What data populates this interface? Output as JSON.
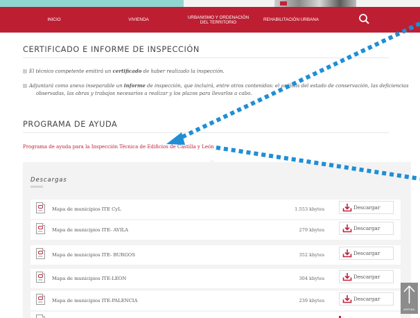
{
  "nav": {
    "items": [
      "INICIO",
      "VIVIENDA",
      "URBANISMO Y ORDENACIÓN\nDEL TERRITORIO",
      "REHABILITACIÓN URBANA"
    ]
  },
  "certificado": {
    "title": "CERTIFICADO E INFORME DE INSPECCIÓN",
    "p1": {
      "a": "El técnico competente emitirá un ",
      "b": "certificado",
      "c": " de haber realizado la inspección."
    },
    "p2": {
      "a": "Adjuntará como anexo inseparable un ",
      "b": "informe",
      "c": " de inspección, que incluirá, entre otros contenidos: el análisis del estado de conservación, las deficiencias",
      "d": "observadas, las obras y trabajos necesarios a realizar y los plazos para llevarlos a cabo."
    }
  },
  "programa": {
    "title": "PROGRAMA DE AYUDA",
    "link": "Programa de ayuda para la Inspección Técnica de Edificios de Castilla y León"
  },
  "descargas": {
    "title": "Descargas",
    "button_label": "Descargar",
    "pdf_label": "PDF",
    "files": [
      {
        "name": "Mapa de municipios ITE CyL",
        "size": "1.553 kbytes"
      },
      {
        "name": "Mapa de municipios ITE- AVILA",
        "size": "279 kbytes"
      },
      {
        "name": "Mapa de municipios ITE- BURGOS",
        "size": "352 kbytes"
      },
      {
        "name": "Mapa de municipios ITE-LEON",
        "size": "304 kbytes"
      },
      {
        "name": "Mapa de municipios ITE-PALENCIA",
        "size": "239 kbytes"
      }
    ]
  },
  "totop": {
    "label": "ARRIBA"
  },
  "colors": {
    "brand_red": "#be1e32",
    "arrow_blue": "#1e8fd6"
  }
}
